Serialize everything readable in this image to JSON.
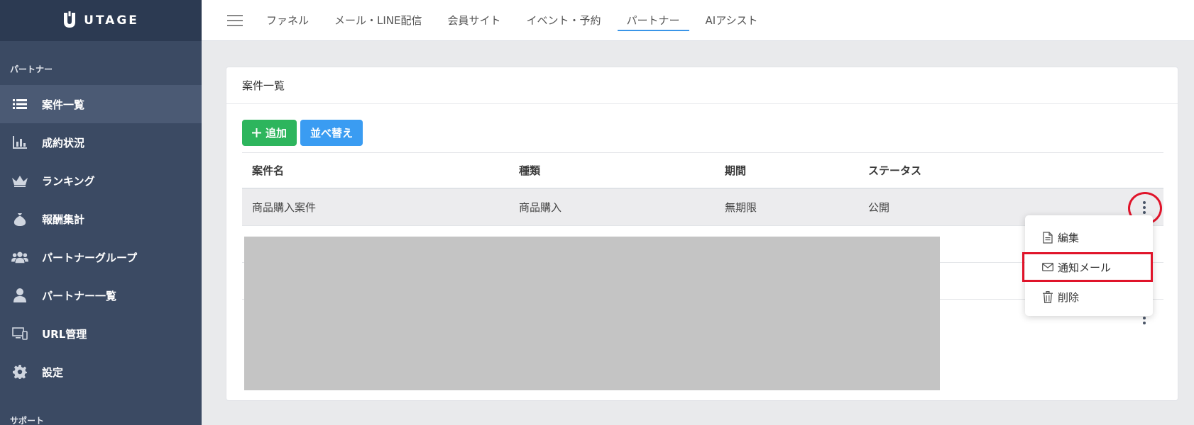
{
  "brand": {
    "name": "UTAGE"
  },
  "sidebar": {
    "section_label": "パートナー",
    "bottom_section_label": "サポート",
    "items": [
      {
        "label": "案件一覧",
        "icon": "list-icon",
        "active": true
      },
      {
        "label": "成約状況",
        "icon": "bar-chart-icon"
      },
      {
        "label": "ランキング",
        "icon": "crown-icon"
      },
      {
        "label": "報酬集計",
        "icon": "money-bag-icon"
      },
      {
        "label": "パートナーグループ",
        "icon": "users-icon"
      },
      {
        "label": "パートナー一覧",
        "icon": "user-icon"
      },
      {
        "label": "URL管理",
        "icon": "devices-icon"
      },
      {
        "label": "設定",
        "icon": "gear-icon"
      }
    ]
  },
  "topnav": {
    "tabs": [
      {
        "label": "ファネル"
      },
      {
        "label": "メール・LINE配信"
      },
      {
        "label": "会員サイト"
      },
      {
        "label": "イベント・予約"
      },
      {
        "label": "パートナー",
        "active": true
      },
      {
        "label": "AIアシスト"
      }
    ]
  },
  "card": {
    "title": "案件一覧",
    "add_button": "追加",
    "sort_button": "並べ替え",
    "table": {
      "headers": [
        "案件名",
        "種類",
        "期間",
        "ステータス"
      ],
      "rows": [
        {
          "name": "商品購入案件",
          "type": "商品購入",
          "period": "無期限",
          "status": "公開"
        }
      ]
    }
  },
  "dropdown": {
    "items": [
      {
        "label": "編集",
        "icon": "document-icon"
      },
      {
        "label": "通知メール",
        "icon": "envelope-icon"
      },
      {
        "label": "削除",
        "icon": "trash-icon"
      }
    ]
  },
  "colors": {
    "sidebar_bg": "#3b4a63",
    "primary_green": "#2db55d",
    "primary_blue": "#3a9cf2",
    "annotation_red": "#e0142a"
  }
}
